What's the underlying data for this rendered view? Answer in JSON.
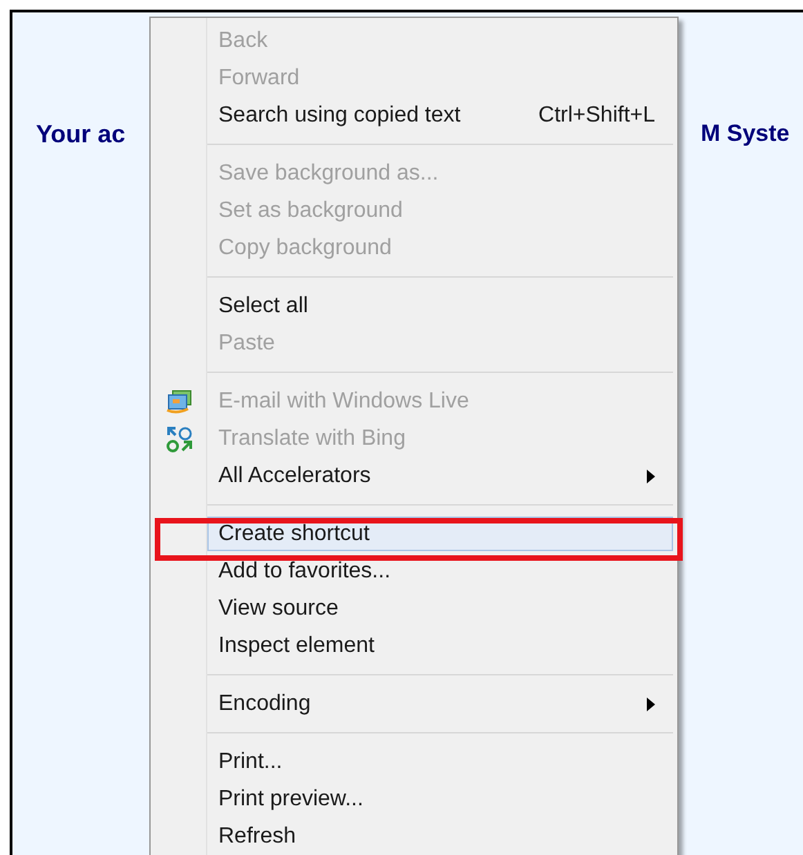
{
  "page": {
    "heading_left": "Your ac",
    "heading_right": "M Syste"
  },
  "context_menu": {
    "sections": [
      {
        "items": [
          {
            "label": "Back",
            "disabled": true,
            "selected": false
          },
          {
            "label": "Forward",
            "disabled": true,
            "selected": false
          },
          {
            "label": "Search using copied text",
            "shortcut": "Ctrl+Shift+L",
            "disabled": false,
            "selected": false
          }
        ]
      },
      {
        "items": [
          {
            "label": "Save background as...",
            "disabled": true,
            "selected": false
          },
          {
            "label": "Set as background",
            "disabled": true,
            "selected": false
          },
          {
            "label": "Copy background",
            "disabled": true,
            "selected": false
          }
        ]
      },
      {
        "items": [
          {
            "label": "Select all",
            "disabled": false,
            "selected": false
          },
          {
            "label": "Paste",
            "disabled": true,
            "selected": false
          }
        ]
      },
      {
        "items": [
          {
            "label": "E-mail with Windows Live",
            "disabled": true,
            "selected": false,
            "kind": "mail"
          },
          {
            "label": "Translate with Bing",
            "disabled": true,
            "selected": false,
            "kind": "translate"
          },
          {
            "label": "All Accelerators",
            "disabled": false,
            "selected": false,
            "kind": "plain",
            "submenu": true
          }
        ]
      },
      {
        "items": [
          {
            "label": "Create shortcut",
            "disabled": false,
            "selected": true,
            "annotated": true
          },
          {
            "label": "Add to favorites...",
            "disabled": false,
            "selected": false
          },
          {
            "label": "View source",
            "disabled": false,
            "selected": false
          },
          {
            "label": "Inspect element",
            "disabled": false,
            "selected": false
          }
        ]
      },
      {
        "items": [
          {
            "label": "Encoding",
            "disabled": false,
            "selected": false,
            "submenu": true
          }
        ]
      },
      {
        "items": [
          {
            "label": "Print...",
            "disabled": false,
            "selected": false
          },
          {
            "label": "Print preview...",
            "disabled": false,
            "selected": false
          },
          {
            "label": "Refresh",
            "disabled": false,
            "selected": false
          }
        ]
      }
    ]
  }
}
